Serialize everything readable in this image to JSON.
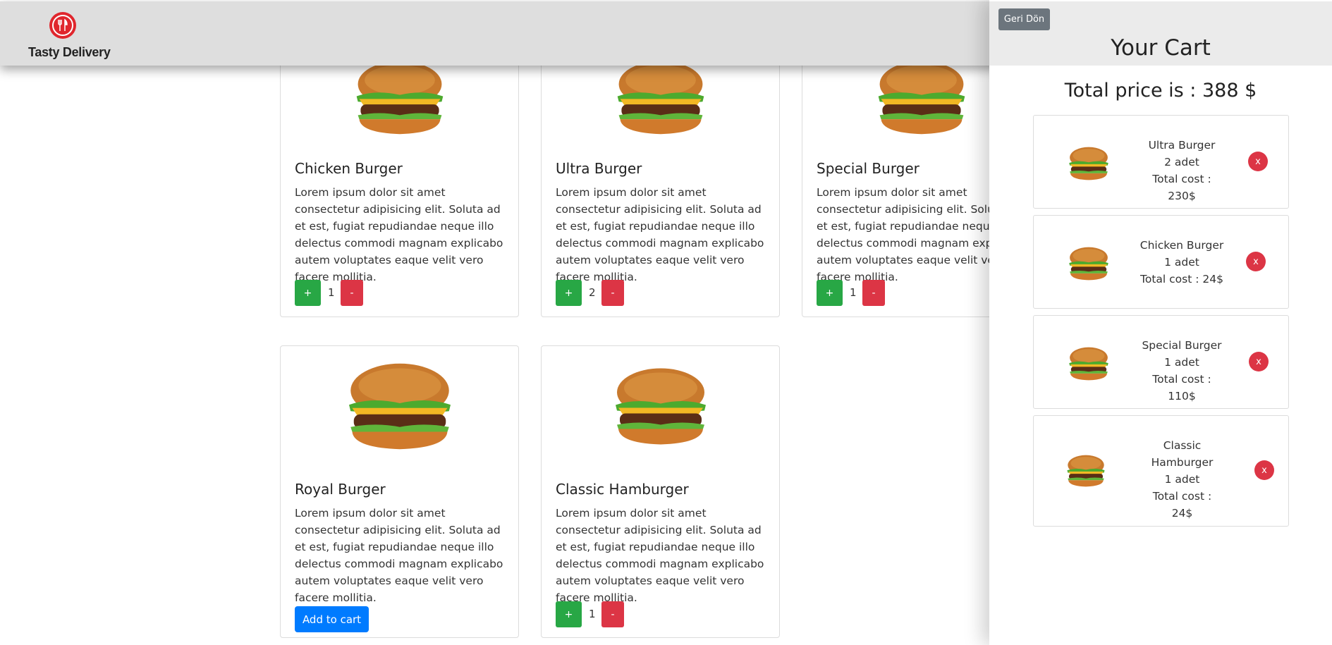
{
  "app": {
    "brand": "Tasty Delivery"
  },
  "products": [
    {
      "name": "Chicken Burger",
      "description": "Lorem ipsum dolor sit amet consectetur adipisicing elit. Soluta ad et est, fugiat repudiandae neque illo delectus commodi magnam explicabo autem voluptates eaque velit vero facere mollitia.",
      "quantity": "1",
      "plus": "+",
      "minus": "-"
    },
    {
      "name": "Ultra Burger",
      "description": "Lorem ipsum dolor sit amet consectetur adipisicing elit. Soluta ad et est, fugiat repudiandae neque illo delectus commodi magnam explicabo autem voluptates eaque velit vero facere mollitia.",
      "quantity": "2",
      "plus": "+",
      "minus": "-"
    },
    {
      "name": "Special Burger",
      "description": "Lorem ipsum dolor sit amet consectetur adipisicing elit. Soluta ad et est, fugiat repudiandae neque illo delectus commodi magnam explicabo autem voluptates eaque velit vero facere mollitia.",
      "quantity": "1",
      "plus": "+",
      "minus": "-"
    },
    {
      "name": "Royal Burger",
      "description": "Lorem ipsum dolor sit amet consectetur adipisicing elit. Soluta ad et est, fugiat repudiandae neque illo delectus commodi magnam explicabo autem voluptates eaque velit vero facere mollitia.",
      "add_label": "Add to cart"
    },
    {
      "name": "Classic Hamburger",
      "description": "Lorem ipsum dolor sit amet consectetur adipisicing elit. Soluta ad et est, fugiat repudiandae neque illo delectus commodi magnam explicabo autem voluptates eaque velit vero facere mollitia.",
      "quantity": "1",
      "plus": "+",
      "minus": "-"
    }
  ],
  "cart": {
    "back_label": "Geri Dön",
    "title": "Your Cart",
    "total_text": "Total price is : 388 $",
    "items": [
      {
        "name": "Ultra Burger",
        "count": "2 adet",
        "cost": "Total cost : 230$",
        "remove": "x"
      },
      {
        "name": "Chicken Burger",
        "count": "1 adet",
        "cost": "Total cost : 24$",
        "remove": "x"
      },
      {
        "name": "Special Burger",
        "count": "1 adet",
        "cost": "Total cost : 110$",
        "remove": "x"
      },
      {
        "name": "Classic Hamburger",
        "count": "1 adet",
        "cost": "Total cost : 24$",
        "remove": "x"
      }
    ]
  },
  "colors": {
    "add": "#28a745",
    "remove": "#dc3545",
    "primary": "#007bff",
    "secondary": "#6c757d",
    "brand": "#e0262d"
  }
}
